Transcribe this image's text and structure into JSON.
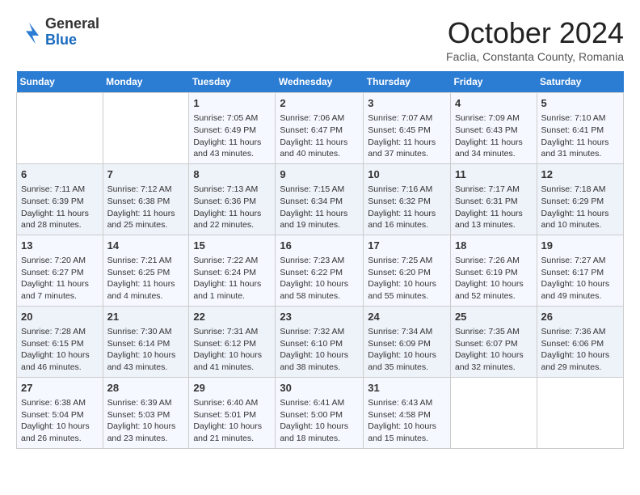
{
  "logo": {
    "general": "General",
    "blue": "Blue"
  },
  "title": "October 2024",
  "subtitle": "Faclia, Constanta County, Romania",
  "days_of_week": [
    "Sunday",
    "Monday",
    "Tuesday",
    "Wednesday",
    "Thursday",
    "Friday",
    "Saturday"
  ],
  "weeks": [
    [
      {
        "day": "",
        "content": ""
      },
      {
        "day": "",
        "content": ""
      },
      {
        "day": "1",
        "content": "Sunrise: 7:05 AM\nSunset: 6:49 PM\nDaylight: 11 hours and 43 minutes."
      },
      {
        "day": "2",
        "content": "Sunrise: 7:06 AM\nSunset: 6:47 PM\nDaylight: 11 hours and 40 minutes."
      },
      {
        "day": "3",
        "content": "Sunrise: 7:07 AM\nSunset: 6:45 PM\nDaylight: 11 hours and 37 minutes."
      },
      {
        "day": "4",
        "content": "Sunrise: 7:09 AM\nSunset: 6:43 PM\nDaylight: 11 hours and 34 minutes."
      },
      {
        "day": "5",
        "content": "Sunrise: 7:10 AM\nSunset: 6:41 PM\nDaylight: 11 hours and 31 minutes."
      }
    ],
    [
      {
        "day": "6",
        "content": "Sunrise: 7:11 AM\nSunset: 6:39 PM\nDaylight: 11 hours and 28 minutes."
      },
      {
        "day": "7",
        "content": "Sunrise: 7:12 AM\nSunset: 6:38 PM\nDaylight: 11 hours and 25 minutes."
      },
      {
        "day": "8",
        "content": "Sunrise: 7:13 AM\nSunset: 6:36 PM\nDaylight: 11 hours and 22 minutes."
      },
      {
        "day": "9",
        "content": "Sunrise: 7:15 AM\nSunset: 6:34 PM\nDaylight: 11 hours and 19 minutes."
      },
      {
        "day": "10",
        "content": "Sunrise: 7:16 AM\nSunset: 6:32 PM\nDaylight: 11 hours and 16 minutes."
      },
      {
        "day": "11",
        "content": "Sunrise: 7:17 AM\nSunset: 6:31 PM\nDaylight: 11 hours and 13 minutes."
      },
      {
        "day": "12",
        "content": "Sunrise: 7:18 AM\nSunset: 6:29 PM\nDaylight: 11 hours and 10 minutes."
      }
    ],
    [
      {
        "day": "13",
        "content": "Sunrise: 7:20 AM\nSunset: 6:27 PM\nDaylight: 11 hours and 7 minutes."
      },
      {
        "day": "14",
        "content": "Sunrise: 7:21 AM\nSunset: 6:25 PM\nDaylight: 11 hours and 4 minutes."
      },
      {
        "day": "15",
        "content": "Sunrise: 7:22 AM\nSunset: 6:24 PM\nDaylight: 11 hours and 1 minute."
      },
      {
        "day": "16",
        "content": "Sunrise: 7:23 AM\nSunset: 6:22 PM\nDaylight: 10 hours and 58 minutes."
      },
      {
        "day": "17",
        "content": "Sunrise: 7:25 AM\nSunset: 6:20 PM\nDaylight: 10 hours and 55 minutes."
      },
      {
        "day": "18",
        "content": "Sunrise: 7:26 AM\nSunset: 6:19 PM\nDaylight: 10 hours and 52 minutes."
      },
      {
        "day": "19",
        "content": "Sunrise: 7:27 AM\nSunset: 6:17 PM\nDaylight: 10 hours and 49 minutes."
      }
    ],
    [
      {
        "day": "20",
        "content": "Sunrise: 7:28 AM\nSunset: 6:15 PM\nDaylight: 10 hours and 46 minutes."
      },
      {
        "day": "21",
        "content": "Sunrise: 7:30 AM\nSunset: 6:14 PM\nDaylight: 10 hours and 43 minutes."
      },
      {
        "day": "22",
        "content": "Sunrise: 7:31 AM\nSunset: 6:12 PM\nDaylight: 10 hours and 41 minutes."
      },
      {
        "day": "23",
        "content": "Sunrise: 7:32 AM\nSunset: 6:10 PM\nDaylight: 10 hours and 38 minutes."
      },
      {
        "day": "24",
        "content": "Sunrise: 7:34 AM\nSunset: 6:09 PM\nDaylight: 10 hours and 35 minutes."
      },
      {
        "day": "25",
        "content": "Sunrise: 7:35 AM\nSunset: 6:07 PM\nDaylight: 10 hours and 32 minutes."
      },
      {
        "day": "26",
        "content": "Sunrise: 7:36 AM\nSunset: 6:06 PM\nDaylight: 10 hours and 29 minutes."
      }
    ],
    [
      {
        "day": "27",
        "content": "Sunrise: 6:38 AM\nSunset: 5:04 PM\nDaylight: 10 hours and 26 minutes."
      },
      {
        "day": "28",
        "content": "Sunrise: 6:39 AM\nSunset: 5:03 PM\nDaylight: 10 hours and 23 minutes."
      },
      {
        "day": "29",
        "content": "Sunrise: 6:40 AM\nSunset: 5:01 PM\nDaylight: 10 hours and 21 minutes."
      },
      {
        "day": "30",
        "content": "Sunrise: 6:41 AM\nSunset: 5:00 PM\nDaylight: 10 hours and 18 minutes."
      },
      {
        "day": "31",
        "content": "Sunrise: 6:43 AM\nSunset: 4:58 PM\nDaylight: 10 hours and 15 minutes."
      },
      {
        "day": "",
        "content": ""
      },
      {
        "day": "",
        "content": ""
      }
    ]
  ]
}
